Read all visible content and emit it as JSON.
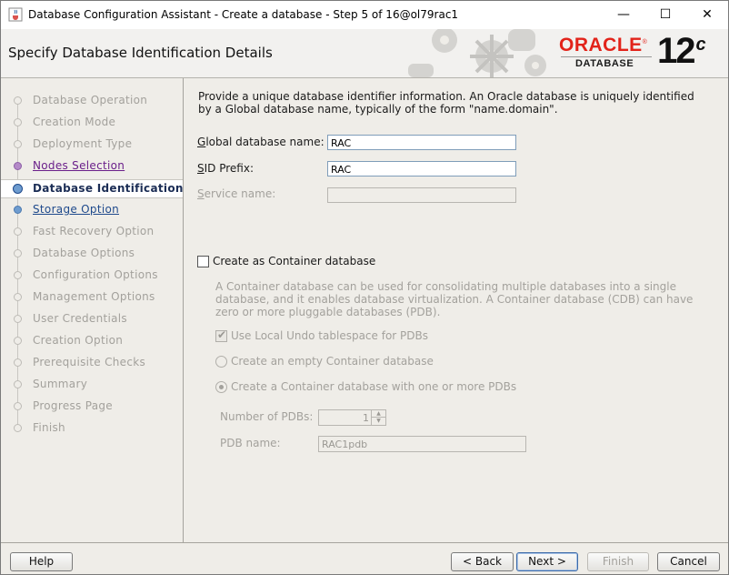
{
  "window": {
    "title": "Database Configuration Assistant - Create a database - Step 5 of 16@ol79rac1",
    "app_icon": "java-cup-icon",
    "controls": [
      "minimize-icon",
      "maximize-icon",
      "close-icon"
    ]
  },
  "header": {
    "page_title": "Specify Database Identification Details",
    "logo_word": "ORACLE",
    "logo_registered": "®",
    "logo_subtitle": "DATABASE",
    "version_number": "12",
    "version_suffix": "c"
  },
  "sidebar": {
    "steps": [
      {
        "label": "Database Operation",
        "state": "done"
      },
      {
        "label": "Creation Mode",
        "state": "done"
      },
      {
        "label": "Deployment Type",
        "state": "done"
      },
      {
        "label": "Nodes Selection",
        "state": "visited"
      },
      {
        "label": "Database Identification",
        "state": "current"
      },
      {
        "label": "Storage Option",
        "state": "link"
      },
      {
        "label": "Fast Recovery Option",
        "state": "disabled"
      },
      {
        "label": "Database Options",
        "state": "disabled"
      },
      {
        "label": "Configuration Options",
        "state": "disabled"
      },
      {
        "label": "Management Options",
        "state": "disabled"
      },
      {
        "label": "User Credentials",
        "state": "disabled"
      },
      {
        "label": "Creation Option",
        "state": "disabled"
      },
      {
        "label": "Prerequisite Checks",
        "state": "disabled"
      },
      {
        "label": "Summary",
        "state": "disabled"
      },
      {
        "label": "Progress Page",
        "state": "disabled"
      },
      {
        "label": "Finish",
        "state": "disabled"
      }
    ]
  },
  "main": {
    "intro": "Provide a unique database identifier information. An Oracle database is uniquely identified by a Global database name, typically of the form \"name.domain\".",
    "global_db_name": {
      "label": "Global database name:",
      "value": "RAC"
    },
    "sid_prefix": {
      "label": "SID Prefix:",
      "value": "RAC"
    },
    "service_name": {
      "label": "Service name:",
      "value": ""
    },
    "container": {
      "checkbox_label": "Create as Container database",
      "checked": false,
      "description": "A Container database can be used for consolidating multiple databases into a single database, and it enables database virtualization. A Container database (CDB) can have zero or more pluggable databases (PDB).",
      "local_undo_label": "Use Local Undo tablespace for PDBs",
      "local_undo_checked": true,
      "empty_cdb_label": "Create an empty Container database",
      "with_pdbs_label": "Create a Container database with one or more PDBs",
      "selected_option": "with_pdbs",
      "num_pdbs_label": "Number of PDBs:",
      "num_pdbs_value": "1",
      "pdb_name_label": "PDB name:",
      "pdb_name_value": "RAC1pdb"
    }
  },
  "footer": {
    "help": "Help",
    "back": "< Back",
    "next": "Next >",
    "finish": "Finish",
    "cancel": "Cancel"
  }
}
